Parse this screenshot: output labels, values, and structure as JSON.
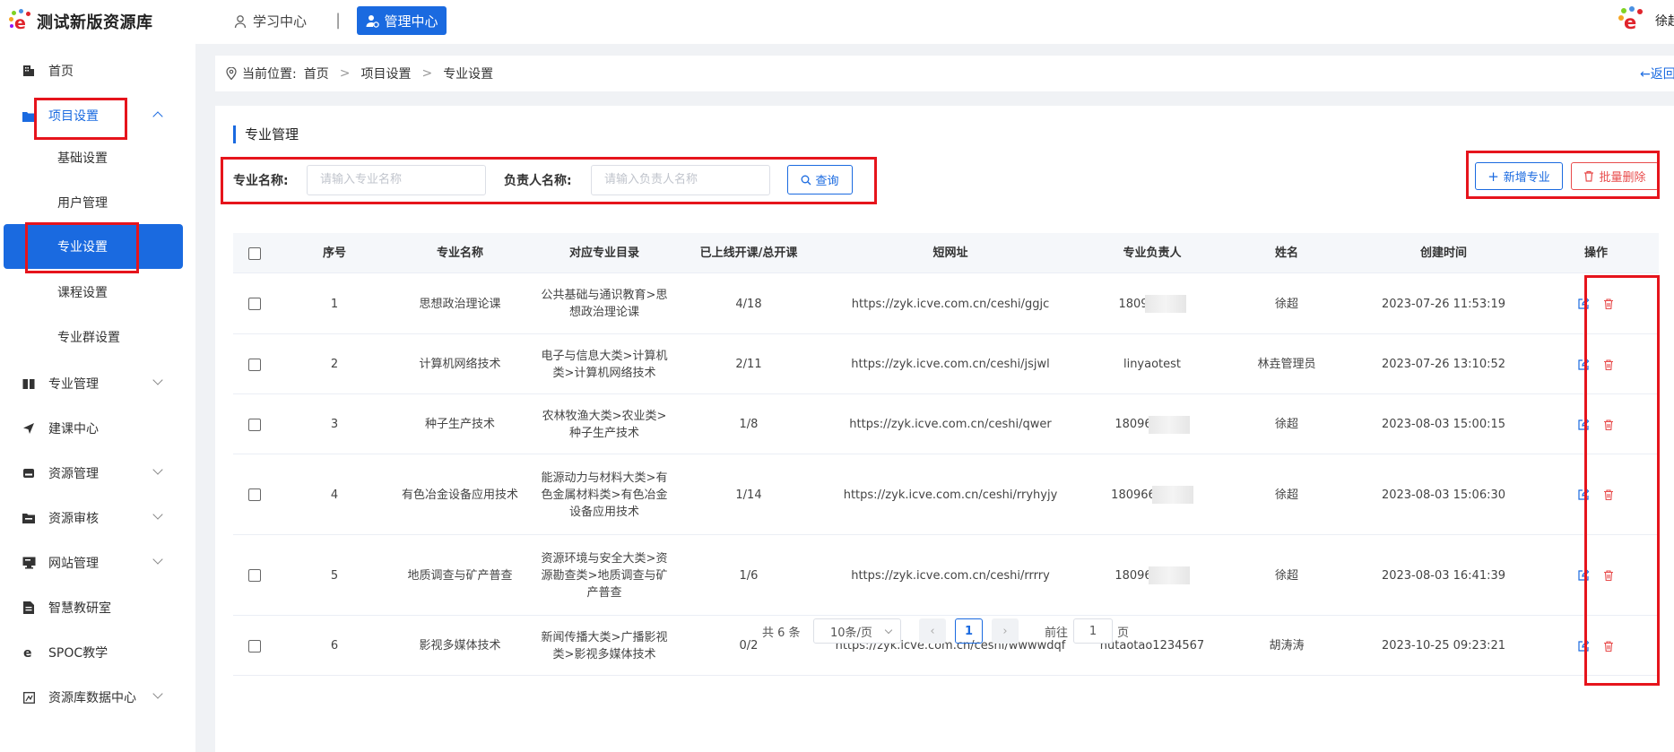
{
  "app": {
    "title": "测试新版资源库",
    "nav_study": "学习中心",
    "nav_sep": "|",
    "nav_admin": "管理中心",
    "user_name": "徐超",
    "brand_color": "#1a6ae0",
    "danger_color": "#e84c4c"
  },
  "sidebar": {
    "items": [
      {
        "label": "首页",
        "icon": "building-icon"
      },
      {
        "label": "项目设置",
        "icon": "folder-icon",
        "expanded": true
      },
      {
        "label": "基础设置"
      },
      {
        "label": "用户管理"
      },
      {
        "label": "专业设置",
        "active": true
      },
      {
        "label": "课程设置"
      },
      {
        "label": "专业群设置"
      },
      {
        "label": "专业管理",
        "icon": "book-icon"
      },
      {
        "label": "建课中心",
        "icon": "send-icon"
      },
      {
        "label": "资源管理",
        "icon": "drive-icon"
      },
      {
        "label": "资源审核",
        "icon": "folder-check-icon"
      },
      {
        "label": "网站管理",
        "icon": "monitor-icon"
      },
      {
        "label": "智慧教研室",
        "icon": "document-icon"
      },
      {
        "label": "SPOC教学",
        "icon": "e-icon"
      },
      {
        "label": "资源库数据中心",
        "icon": "chart-box-icon"
      }
    ]
  },
  "breadcrumb": {
    "prefix": "当前位置:",
    "items": [
      "首页",
      "项目设置",
      "专业设置"
    ],
    "separator": ">",
    "back": "←返回"
  },
  "section_title": "专业管理",
  "filters": {
    "major_label": "专业名称:",
    "major_placeholder": "请输入专业名称",
    "owner_label": "负责人名称:",
    "owner_placeholder": "请输入负责人名称",
    "query": "查询"
  },
  "actions": {
    "add": "新增专业",
    "batch_delete": "批量删除"
  },
  "table": {
    "headers": [
      "序号",
      "专业名称",
      "对应专业目录",
      "已上线开课/总开课",
      "短网址",
      "专业负责人",
      "姓名",
      "创建时间",
      "操作"
    ],
    "rows": [
      {
        "no": "1",
        "name": "思想政治理论课",
        "catalog": [
          "公共基础与通识教育>思",
          "想政治理论课"
        ],
        "courses": "4/18",
        "url": "https://zyk.icve.com.cn/ceshi/ggjc",
        "owner": "1809",
        "owner_masked": true,
        "person": "徐超",
        "created": "2023-07-26 11:53:19"
      },
      {
        "no": "2",
        "name": "计算机网络技术",
        "catalog": [
          "电子与信息大类>计算机",
          "类>计算机网络技术"
        ],
        "courses": "2/11",
        "url": "https://zyk.icve.com.cn/ceshi/jsjwl",
        "owner": "linyaotest",
        "owner_masked": false,
        "person": "林垚管理员",
        "created": "2023-07-26 13:10:52"
      },
      {
        "no": "3",
        "name": "种子生产技术",
        "catalog": [
          "农林牧渔大类>农业类>",
          "种子生产技术"
        ],
        "courses": "1/8",
        "url": "https://zyk.icve.com.cn/ceshi/qwer",
        "owner": "18096",
        "owner_masked": true,
        "person": "徐超",
        "created": "2023-08-03 15:00:15"
      },
      {
        "no": "4",
        "name": "有色冶金设备应用技术",
        "catalog": [
          "能源动力与材料大类>有",
          "色金属材料类>有色冶金",
          "设备应用技术"
        ],
        "courses": "1/14",
        "url": "https://zyk.icve.com.cn/ceshi/rryhyjy",
        "owner": "180966",
        "owner_masked": true,
        "person": "徐超",
        "created": "2023-08-03 15:06:30"
      },
      {
        "no": "5",
        "name": "地质调查与矿产普查",
        "catalog": [
          "资源环境与安全大类>资",
          "源勘查类>地质调查与矿",
          "产普查"
        ],
        "courses": "1/6",
        "url": "https://zyk.icve.com.cn/ceshi/rrrry",
        "owner": "18096",
        "owner_masked": true,
        "person": "徐超",
        "created": "2023-08-03 16:41:39"
      },
      {
        "no": "6",
        "name": "影视多媒体技术",
        "catalog": [
          "新闻传播大类>广播影视",
          "类>影视多媒体技术"
        ],
        "courses": "0/2",
        "url": "https://zyk.icve.com.cn/ceshi/wwwwdqf",
        "owner": "hutaotao1234567",
        "owner_masked": false,
        "person": "胡涛涛",
        "created": "2023-10-25 09:23:21"
      }
    ]
  },
  "pagination": {
    "total": "共 6 条",
    "page_size": "10条/页",
    "current": "1",
    "goto_prefix": "前往",
    "goto_value": "1",
    "goto_suffix": "页"
  }
}
